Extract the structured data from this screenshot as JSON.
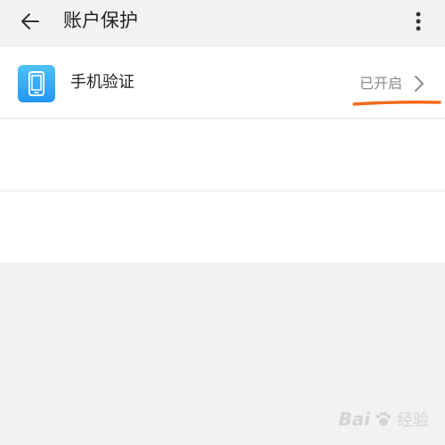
{
  "header": {
    "title": "账户保护",
    "back_icon": "arrow-left-icon",
    "more_icon": "more-vertical-icon"
  },
  "list": {
    "items": [
      {
        "label": "手机验证",
        "status": "已开启",
        "icon": "phone-icon",
        "chevron_icon": "chevron-right-icon"
      }
    ]
  },
  "watermark": {
    "brand": "Bai",
    "suffix": "经验",
    "icon": "paw-icon"
  },
  "colors": {
    "background": "#f2f2f2",
    "card": "#ffffff",
    "icon_gradient_top": "#4fc3f7",
    "icon_gradient_bottom": "#2196f3",
    "annotation_underline": "#f26a1b",
    "status_text": "#8a8a8a"
  }
}
